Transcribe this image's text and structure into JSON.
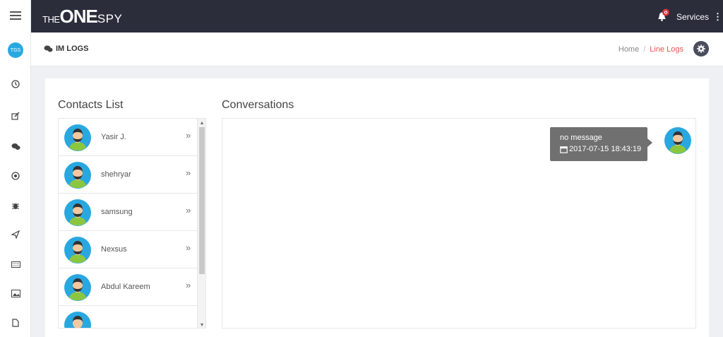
{
  "rail": {
    "avatar_initials": "TGS",
    "items": [
      "menu-icon",
      "clock-icon",
      "edit-icon",
      "chat-icon",
      "target-icon",
      "bug-icon",
      "send-icon",
      "keyboard-icon",
      "image-icon",
      "file-icon"
    ]
  },
  "topbar": {
    "logo": {
      "the": "THE",
      "one": "ONE",
      "spy": "SPY"
    },
    "services_label": "Services",
    "kebab": "⋮"
  },
  "header": {
    "title": "IM LOGS",
    "breadcrumb": {
      "home": "Home",
      "sep": "/",
      "current": "Line Logs"
    }
  },
  "contacts": {
    "title": "Contacts List",
    "items": [
      {
        "name": "Yasir J."
      },
      {
        "name": "shehryar"
      },
      {
        "name": "samsung"
      },
      {
        "name": "Nexsus"
      },
      {
        "name": "Abdul Kareem"
      }
    ],
    "chevron": "»",
    "scroll_up": "▴",
    "scroll_down": "▾"
  },
  "conversation": {
    "title": "Conversations",
    "messages": [
      {
        "text": "no message",
        "timestamp": "2017-07-15 18:43:19"
      }
    ]
  },
  "colors": {
    "topbar": "#2b2d3b",
    "accent_red": "#e0564b",
    "avatar_blue": "#29a8e0",
    "bubble_gray": "#707070"
  }
}
